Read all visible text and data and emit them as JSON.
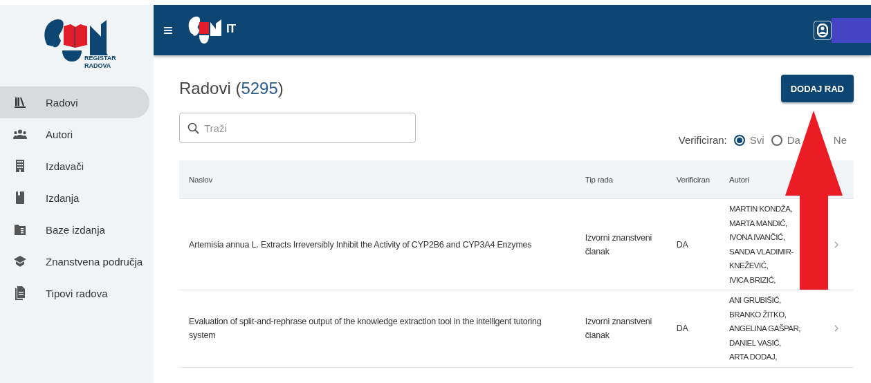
{
  "sidebar": {
    "logo_text": [
      "REGISTAR",
      "RADOVA"
    ],
    "items": [
      {
        "label": "Radovi",
        "selected": true
      },
      {
        "label": "Autori",
        "selected": false
      },
      {
        "label": "Izdavači",
        "selected": false
      },
      {
        "label": "Izdanja",
        "selected": false
      },
      {
        "label": "Baze izdanja",
        "selected": false
      },
      {
        "label": "Znanstvena područja",
        "selected": false
      },
      {
        "label": "Tipovi radova",
        "selected": false
      }
    ]
  },
  "header": {
    "menu_icon": "≡",
    "logo_text": "IT"
  },
  "page": {
    "title": "Radovi",
    "count": "5295",
    "count_brackets": [
      "(",
      ")"
    ],
    "add_button": "DODAJ RAD"
  },
  "search": {
    "placeholder": "Traži"
  },
  "filter": {
    "label": "Verificiran:",
    "options": [
      {
        "label": "Svi",
        "selected": true
      },
      {
        "label": "Da",
        "selected": false
      },
      {
        "label": "Ne"
      }
    ]
  },
  "table": {
    "columns": [
      "Naslov",
      "Tip rada",
      "Verificiran",
      "Autori"
    ],
    "rows": [
      {
        "title": "Artemisia annua L. Extracts Irreversibly Inhibit the Activity of CYP2B6 and CYP3A4 Enzymes",
        "type": "Izvorni znanstveni članak",
        "verified": "DA",
        "authors": [
          "MARTIN KONDŽA,",
          "MARTA MANDIĆ,",
          "IVONA IVANČIĆ,",
          "SANDA VLADIMIR-KNEŽEVIĆ,",
          "IVICA BRIZIĆ,"
        ]
      },
      {
        "title": "Evaluation of split-and-rephrase output of the knowledge extraction tool in the intelligent tutoring system",
        "type": "Izvorni znanstveni članak",
        "verified": "DA",
        "authors": [
          "ANI GRUBIŠIĆ,",
          "BRANKO ŽITKO,",
          "ANGELINA GAŠPAR,",
          "DANIEL VASIĆ,",
          "ARTA DODAJ,"
        ]
      }
    ]
  }
}
